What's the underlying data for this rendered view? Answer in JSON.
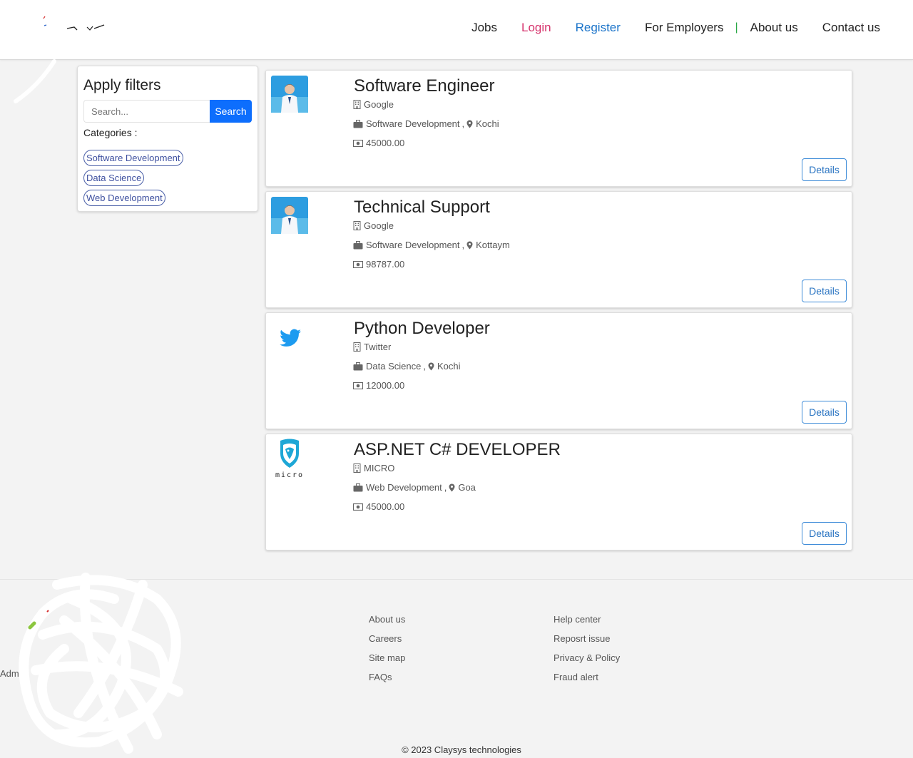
{
  "nav": {
    "jobs": "Jobs",
    "login": "Login",
    "register": "Register",
    "employers": "For Employers",
    "separator": "|",
    "about": "About us",
    "contact": "Contact us"
  },
  "filters": {
    "title": "Apply filters",
    "search_placeholder": "Search...",
    "search_button": "Search",
    "categories_label": "Categories :",
    "categories": [
      "Software Development",
      "Data Science",
      "Web Development"
    ]
  },
  "jobs": [
    {
      "title": "Software Engineer",
      "company": "Google",
      "category": "Software Development",
      "location": "Kochi",
      "salary": "45000.00",
      "logo": "person-photo",
      "button": "Details"
    },
    {
      "title": "Technical Support",
      "company": "Google",
      "category": "Software Development",
      "location": "Kottaym",
      "salary": "98787.00",
      "logo": "person-photo",
      "button": "Details"
    },
    {
      "title": "Python Developer",
      "company": "Twitter",
      "category": "Data Science",
      "location": "Kochi",
      "salary": "12000.00",
      "logo": "twitter-bird-logo",
      "button": "Details"
    },
    {
      "title": "ASP.NET C# DEVELOPER",
      "company": "MICRO",
      "category": "Web Development",
      "location": "Goa",
      "salary": "45000.00",
      "logo": "micro-shield-logo",
      "button": "Details",
      "logo_text": "micro"
    }
  ],
  "footer": {
    "col1": [
      "About us",
      "Careers",
      "Site map",
      "FAQs"
    ],
    "col2": [
      "Help center",
      "Repos‌rt issue",
      "Privacy & Policy",
      "Fraud alert"
    ],
    "admin_fragment": "Adm",
    "copyright": "© 2023 Claysys technologies"
  },
  "colors": {
    "login": "#d6336c",
    "register": "#1a73c9",
    "primary_button": "#0d6efd",
    "chip_border": "#4a5fa8",
    "twitter": "#1d9bf0"
  }
}
